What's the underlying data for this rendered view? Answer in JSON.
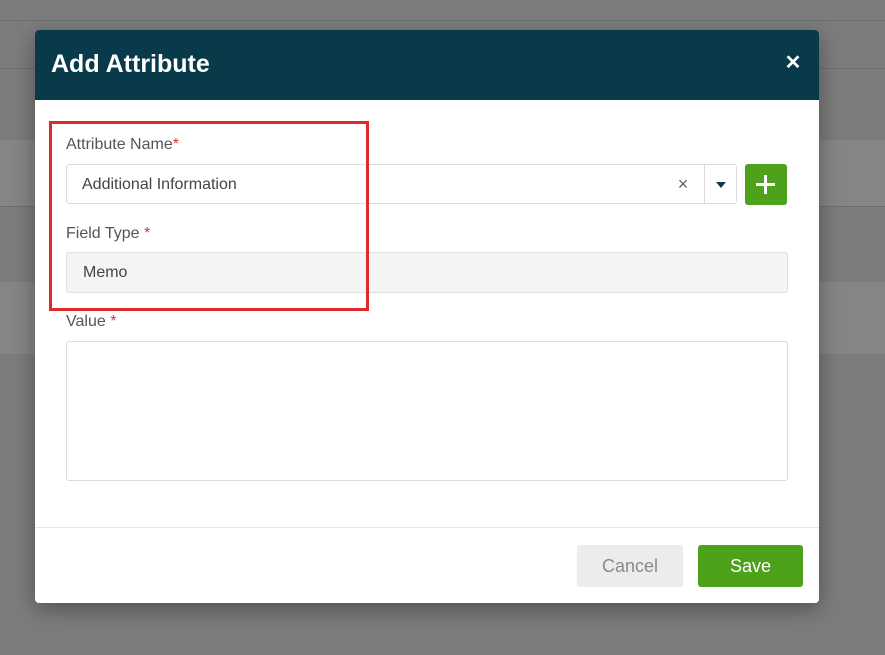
{
  "dialog": {
    "title": "Add Attribute",
    "close_glyph": "✕",
    "close_icon": "close-icon"
  },
  "form": {
    "attribute_name": {
      "label": "Attribute Name",
      "required_mark": "*",
      "value": "Additional Information",
      "clear_glyph": "×",
      "clear_icon": "clear-icon",
      "dropdown_icon": "caret-down-icon",
      "add_icon": "plus-icon"
    },
    "field_type": {
      "label": "Field Type",
      "required_mark": "*",
      "value": "Memo"
    },
    "value": {
      "label": "Value",
      "required_mark": "*",
      "value": ""
    }
  },
  "footer": {
    "cancel_label": "Cancel",
    "save_label": "Save"
  },
  "colors": {
    "header_bg": "#083a4a",
    "accent_green": "#4ea11a",
    "required_red": "#e03030",
    "highlight_red": "#e02a2a",
    "overlay": "#7c7c7c"
  }
}
